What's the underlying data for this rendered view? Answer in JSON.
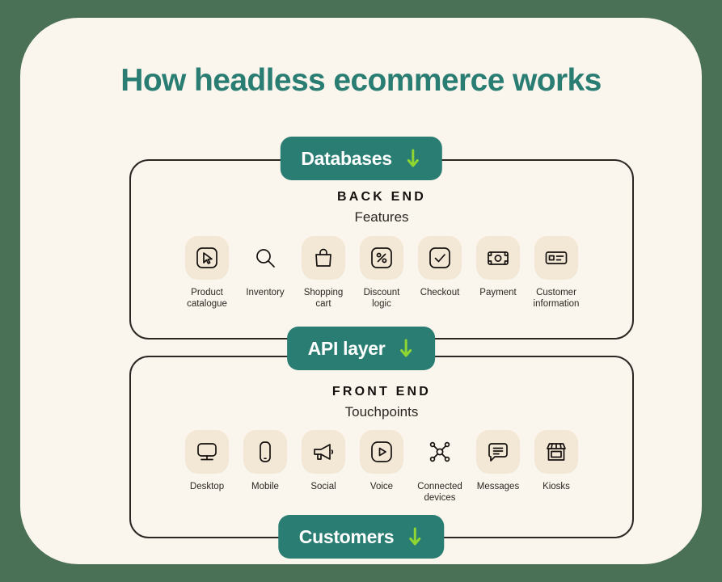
{
  "page": {
    "title": "How headless ecommerce works",
    "background_color": "#4a7055",
    "card_color": "#faf5ed",
    "accent_teal": "#2a7d72",
    "accent_green": "#8fd632",
    "tile_color": "#f3e7d6"
  },
  "pills": [
    {
      "label": "Databases",
      "icon": "arrow-down-icon"
    },
    {
      "label": "API layer",
      "icon": "arrow-down-icon"
    },
    {
      "label": "Customers",
      "icon": "arrow-down-icon"
    }
  ],
  "sections": [
    {
      "kicker": "BACK END",
      "subtitle": "Features",
      "items": [
        {
          "label": "Product\ncatalogue",
          "icon": "cursor-icon",
          "tile": true
        },
        {
          "label": "Inventory",
          "icon": "search-icon",
          "tile": false
        },
        {
          "label": "Shopping\ncart",
          "icon": "shopping-bag-icon",
          "tile": true
        },
        {
          "label": "Discount\nlogic",
          "icon": "percent-icon",
          "tile": true
        },
        {
          "label": "Checkout",
          "icon": "check-icon",
          "tile": true
        },
        {
          "label": "Payment",
          "icon": "banknote-icon",
          "tile": true
        },
        {
          "label": "Customer\ninformation",
          "icon": "id-card-icon",
          "tile": true
        }
      ]
    },
    {
      "kicker": "FRONT END",
      "subtitle": "Touchpoints",
      "items": [
        {
          "label": "Desktop",
          "icon": "monitor-icon",
          "tile": true
        },
        {
          "label": "Mobile",
          "icon": "smartphone-icon",
          "tile": true
        },
        {
          "label": "Social",
          "icon": "megaphone-icon",
          "tile": true
        },
        {
          "label": "Voice",
          "icon": "play-button-icon",
          "tile": true
        },
        {
          "label": "Connected\ndevices",
          "icon": "network-nodes-icon",
          "tile": false
        },
        {
          "label": "Messages",
          "icon": "message-bubble-icon",
          "tile": true
        },
        {
          "label": "Kiosks",
          "icon": "storefront-icon",
          "tile": true
        }
      ]
    }
  ]
}
